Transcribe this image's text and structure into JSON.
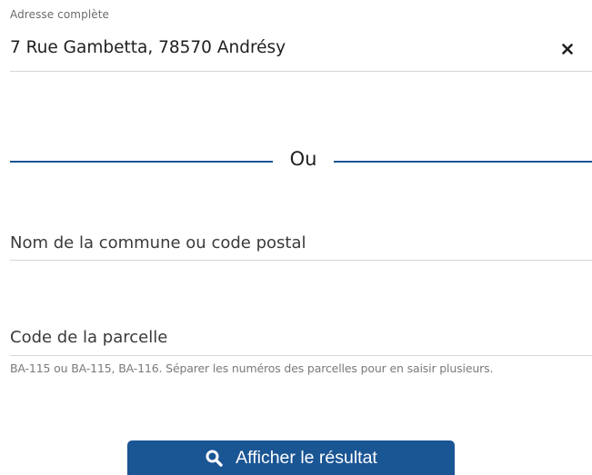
{
  "address_field": {
    "label": "Adresse complète",
    "value": "7 Rue Gambetta, 78570 Andrésy",
    "clear_icon": "close-icon"
  },
  "separator": {
    "text": "Ou",
    "color": "#1a5594"
  },
  "commune_field": {
    "placeholder": "Nom de la commune ou code postal"
  },
  "parcel_field": {
    "placeholder": "Code de la parcelle",
    "hint": "BA-115 ou BA-115, BA-116. Séparer les numéros des parcelles pour en saisir plusieurs."
  },
  "submit": {
    "label": "Afficher le résultat",
    "icon": "search-icon",
    "color": "#1a5594"
  }
}
